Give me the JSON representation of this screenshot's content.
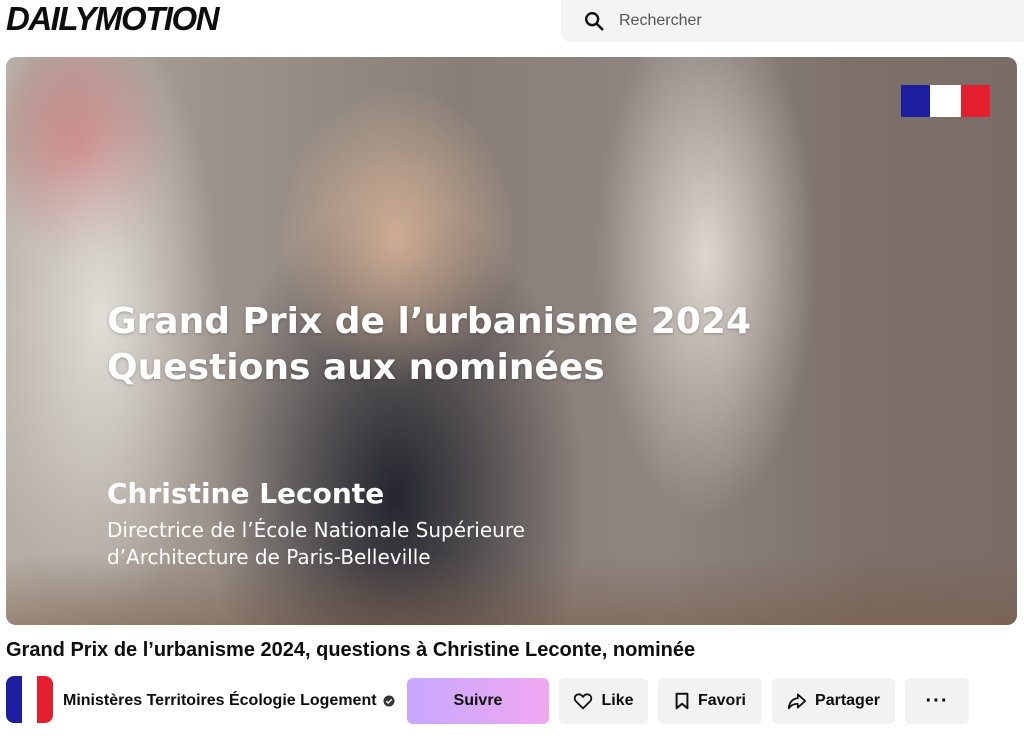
{
  "header": {
    "logo": "DAILYMOTION",
    "search_placeholder": "Rechercher"
  },
  "player": {
    "overlay_title_line1": "Grand Prix de l’urbanisme 2024",
    "overlay_title_line2": "Questions aux nominées",
    "overlay_name": "Christine Leconte",
    "overlay_role_line1": "Directrice de l’École Nationale Supérieure",
    "overlay_role_line2": "d’Architecture de Paris-Belleville"
  },
  "video": {
    "title": "Grand Prix de l’urbanisme 2024, questions à Christine Leconte, nominée"
  },
  "channel": {
    "name": "Ministères Territoires Écologie Logement"
  },
  "actions": {
    "follow": "Suivre",
    "like": "Like",
    "favorite": "Favori",
    "share": "Partager",
    "more": "···"
  },
  "colors": {
    "follow_gradient_start": "#c6a8ff",
    "follow_gradient_end": "#f0a8f0",
    "flag_blue": "#1e1ea0",
    "flag_red": "#e4202e"
  },
  "icons": [
    "search-icon",
    "verified-icon",
    "heart-icon",
    "bookmark-icon",
    "share-icon",
    "more-icon"
  ]
}
